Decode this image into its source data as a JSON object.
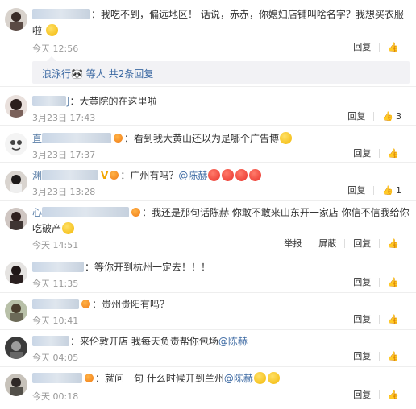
{
  "actions": {
    "reply": "回复",
    "report": "举报",
    "delete": "屏蔽"
  },
  "colors": {
    "link": "#eb7350",
    "mention": "#3d6aa3",
    "meta": "#999999"
  },
  "comments": [
    {
      "user_tail": "",
      "text": "：我吃不到，偏远地区！ 话说，赤赤，你媳妇店铺叫啥名字？我想买衣服啦",
      "time": "今天 12:56",
      "reply_label": "回复",
      "likes": "",
      "reply_summary": "浪泳行🐼 等人  共2条回复"
    },
    {
      "user_tail": "J",
      "text": "：大黄院的在这里啦",
      "time": "3月23日 17:43",
      "reply_label": "回复",
      "likes": "3"
    },
    {
      "user_tail": "直",
      "text": "：看到我大黄山还以为是哪个广告博",
      "time": "3月23日 17:37",
      "reply_label": "回复",
      "likes": ""
    },
    {
      "user_tail": "渊",
      "text_prefix": "：广州有吗？",
      "mention": "@陈赫",
      "time": "3月23日 13:28",
      "reply_label": "回复",
      "likes": "1"
    },
    {
      "user_tail": "心",
      "text": "：我还是那句话陈赫 你敢不敢来山东开一家店 你信不信我给你吃破产",
      "time": "今天 14:51",
      "report_label": "举报",
      "delete_label": "屏蔽",
      "reply_label": "回复",
      "likes": ""
    },
    {
      "user_tail": "",
      "text": "：等你开到杭州一定去！！！",
      "time": "今天 11:35",
      "reply_label": "回复",
      "likes": ""
    },
    {
      "user_tail": "",
      "text": "：贵州贵阳有吗？",
      "time": "今天 10:41",
      "reply_label": "回复",
      "likes": ""
    },
    {
      "user_tail": "",
      "text_prefix": "：来伦敦开店 我每天负责帮你包场",
      "mention": "@陈赫",
      "time": "今天 04:05",
      "reply_label": "回复",
      "likes": ""
    },
    {
      "user_tail": "",
      "text_prefix": "：就问一句   什么时候开到兰州",
      "mention": "@陈赫",
      "time": "今天 00:18",
      "reply_label": "回复",
      "likes": ""
    }
  ]
}
